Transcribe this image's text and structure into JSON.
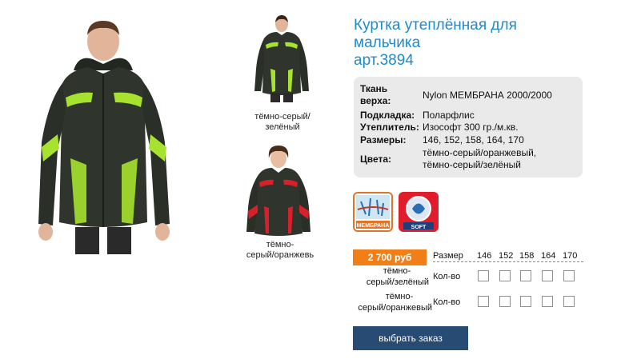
{
  "product": {
    "title_line1": "Куртка утеплённая для",
    "title_line2": "мальчика",
    "article": "арт.3894"
  },
  "thumbnails": [
    {
      "caption_line1": "тёмно-серый/",
      "caption_line2": "зелёный"
    },
    {
      "caption_line1": "тёмно-",
      "caption_line2": "серый/оранжевь"
    }
  ],
  "specs": [
    {
      "label_line1": "Ткань",
      "label_line2": "верха:",
      "value": "Nylon МЕМБРАНА 2000/2000"
    },
    {
      "label": "Подкладка:",
      "value": "Поларфлис"
    },
    {
      "label": "Утеплитель:",
      "value": "Изософт 300 гр./м.кв."
    },
    {
      "label": "Размеры:",
      "value": "146, 152, 158, 164, 170"
    },
    {
      "label": "Цвета:",
      "value_line1": "тёмно-серый/оранжевый,",
      "value_line2": "тёмно-серый/зелёный"
    }
  ],
  "badges": {
    "membrana": "МЕМБРАНА",
    "soft": "SOFT"
  },
  "price": "2 700 руб",
  "order": {
    "size_header": "Размер",
    "sizes": [
      "146",
      "152",
      "158",
      "164",
      "170"
    ],
    "qty_label": "Кол-во",
    "rows": [
      {
        "color_line1": "тёмно-",
        "color_line2": "серый/зелёный"
      },
      {
        "color_line1": "тёмно-",
        "color_line2": "серый/оранжевый"
      }
    ],
    "submit_label": "выбрать заказ"
  },
  "colors": {
    "title": "#1f8bc9",
    "price_bg": "#f07f18",
    "button_bg": "#284b73",
    "spec_bg": "#eaeaea",
    "jacket_green": "#a6e22e",
    "jacket_red": "#d8202a",
    "jacket_body": "#2f352c"
  }
}
